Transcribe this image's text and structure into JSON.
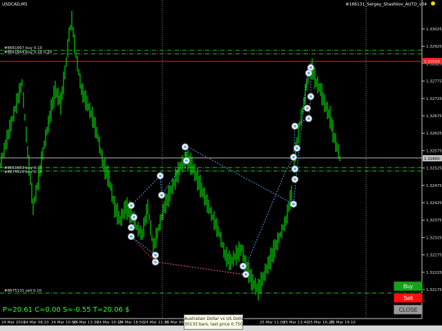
{
  "window": {
    "symbol_title": "USDCAD,M5",
    "ea_title": "#166131_Sergey_Shashkov_AUTO_v04"
  },
  "price_axis": {
    "labels": [
      "1.33025",
      "1.32925",
      "1.32825",
      "1.32775",
      "1.32725",
      "1.32675",
      "1.32625",
      "1.32575",
      "1.32525",
      "1.32475",
      "1.32425",
      "1.32375",
      "1.32325",
      "1.32275",
      "1.32225",
      "1.32175"
    ],
    "current_price": "1.33010",
    "bid_price": "1.32800"
  },
  "time_axis": {
    "labels": [
      "24 Mar 2016",
      "24 Mar 08:10",
      "24 Mar 10:50",
      "24 Mar 13:30",
      "24 Mar 16:10",
      "24 Mar 18:50",
      "24 Mar 21:30",
      "25 Mar 00:10",
      "08:20",
      "25 Mar 11:00",
      "25 Mar 13:40",
      "25 Mar 16:20",
      "25 Mar 19:10"
    ]
  },
  "order_lines": [
    {
      "label": "#8661667 buy 0.10",
      "color": "#2ec42e"
    },
    {
      "label": "#8661664 buy 0.10 0.20",
      "color": "#2ec42e"
    },
    {
      "label": "#8661683 buy 0.10",
      "color": "#2ec42e"
    },
    {
      "label": "#8675520 buy 0.10",
      "color": "#2ec42e"
    },
    {
      "label": "#8675131 sell 0.10",
      "color": "#2ec42e"
    }
  ],
  "buttons": {
    "buy": "Buy",
    "sell": "Sell",
    "close": "CLOSE"
  },
  "stats": {
    "text": "P=20.61  C=0.00  S=-0.55  T=20.06 $"
  },
  "tooltip": {
    "line1": "Australian Dollar vs US Dollar",
    "line2": "30133 bars, last price 0.75011"
  },
  "colors": {
    "background": "#000000",
    "candles": "#00ff00",
    "order_line": "#2ec42e",
    "price_line_red": "#ff2020",
    "bid_line": "#c0c0c0",
    "trade_line_buy": "#4fb0ff",
    "trade_line_sell": "#ff3030"
  }
}
